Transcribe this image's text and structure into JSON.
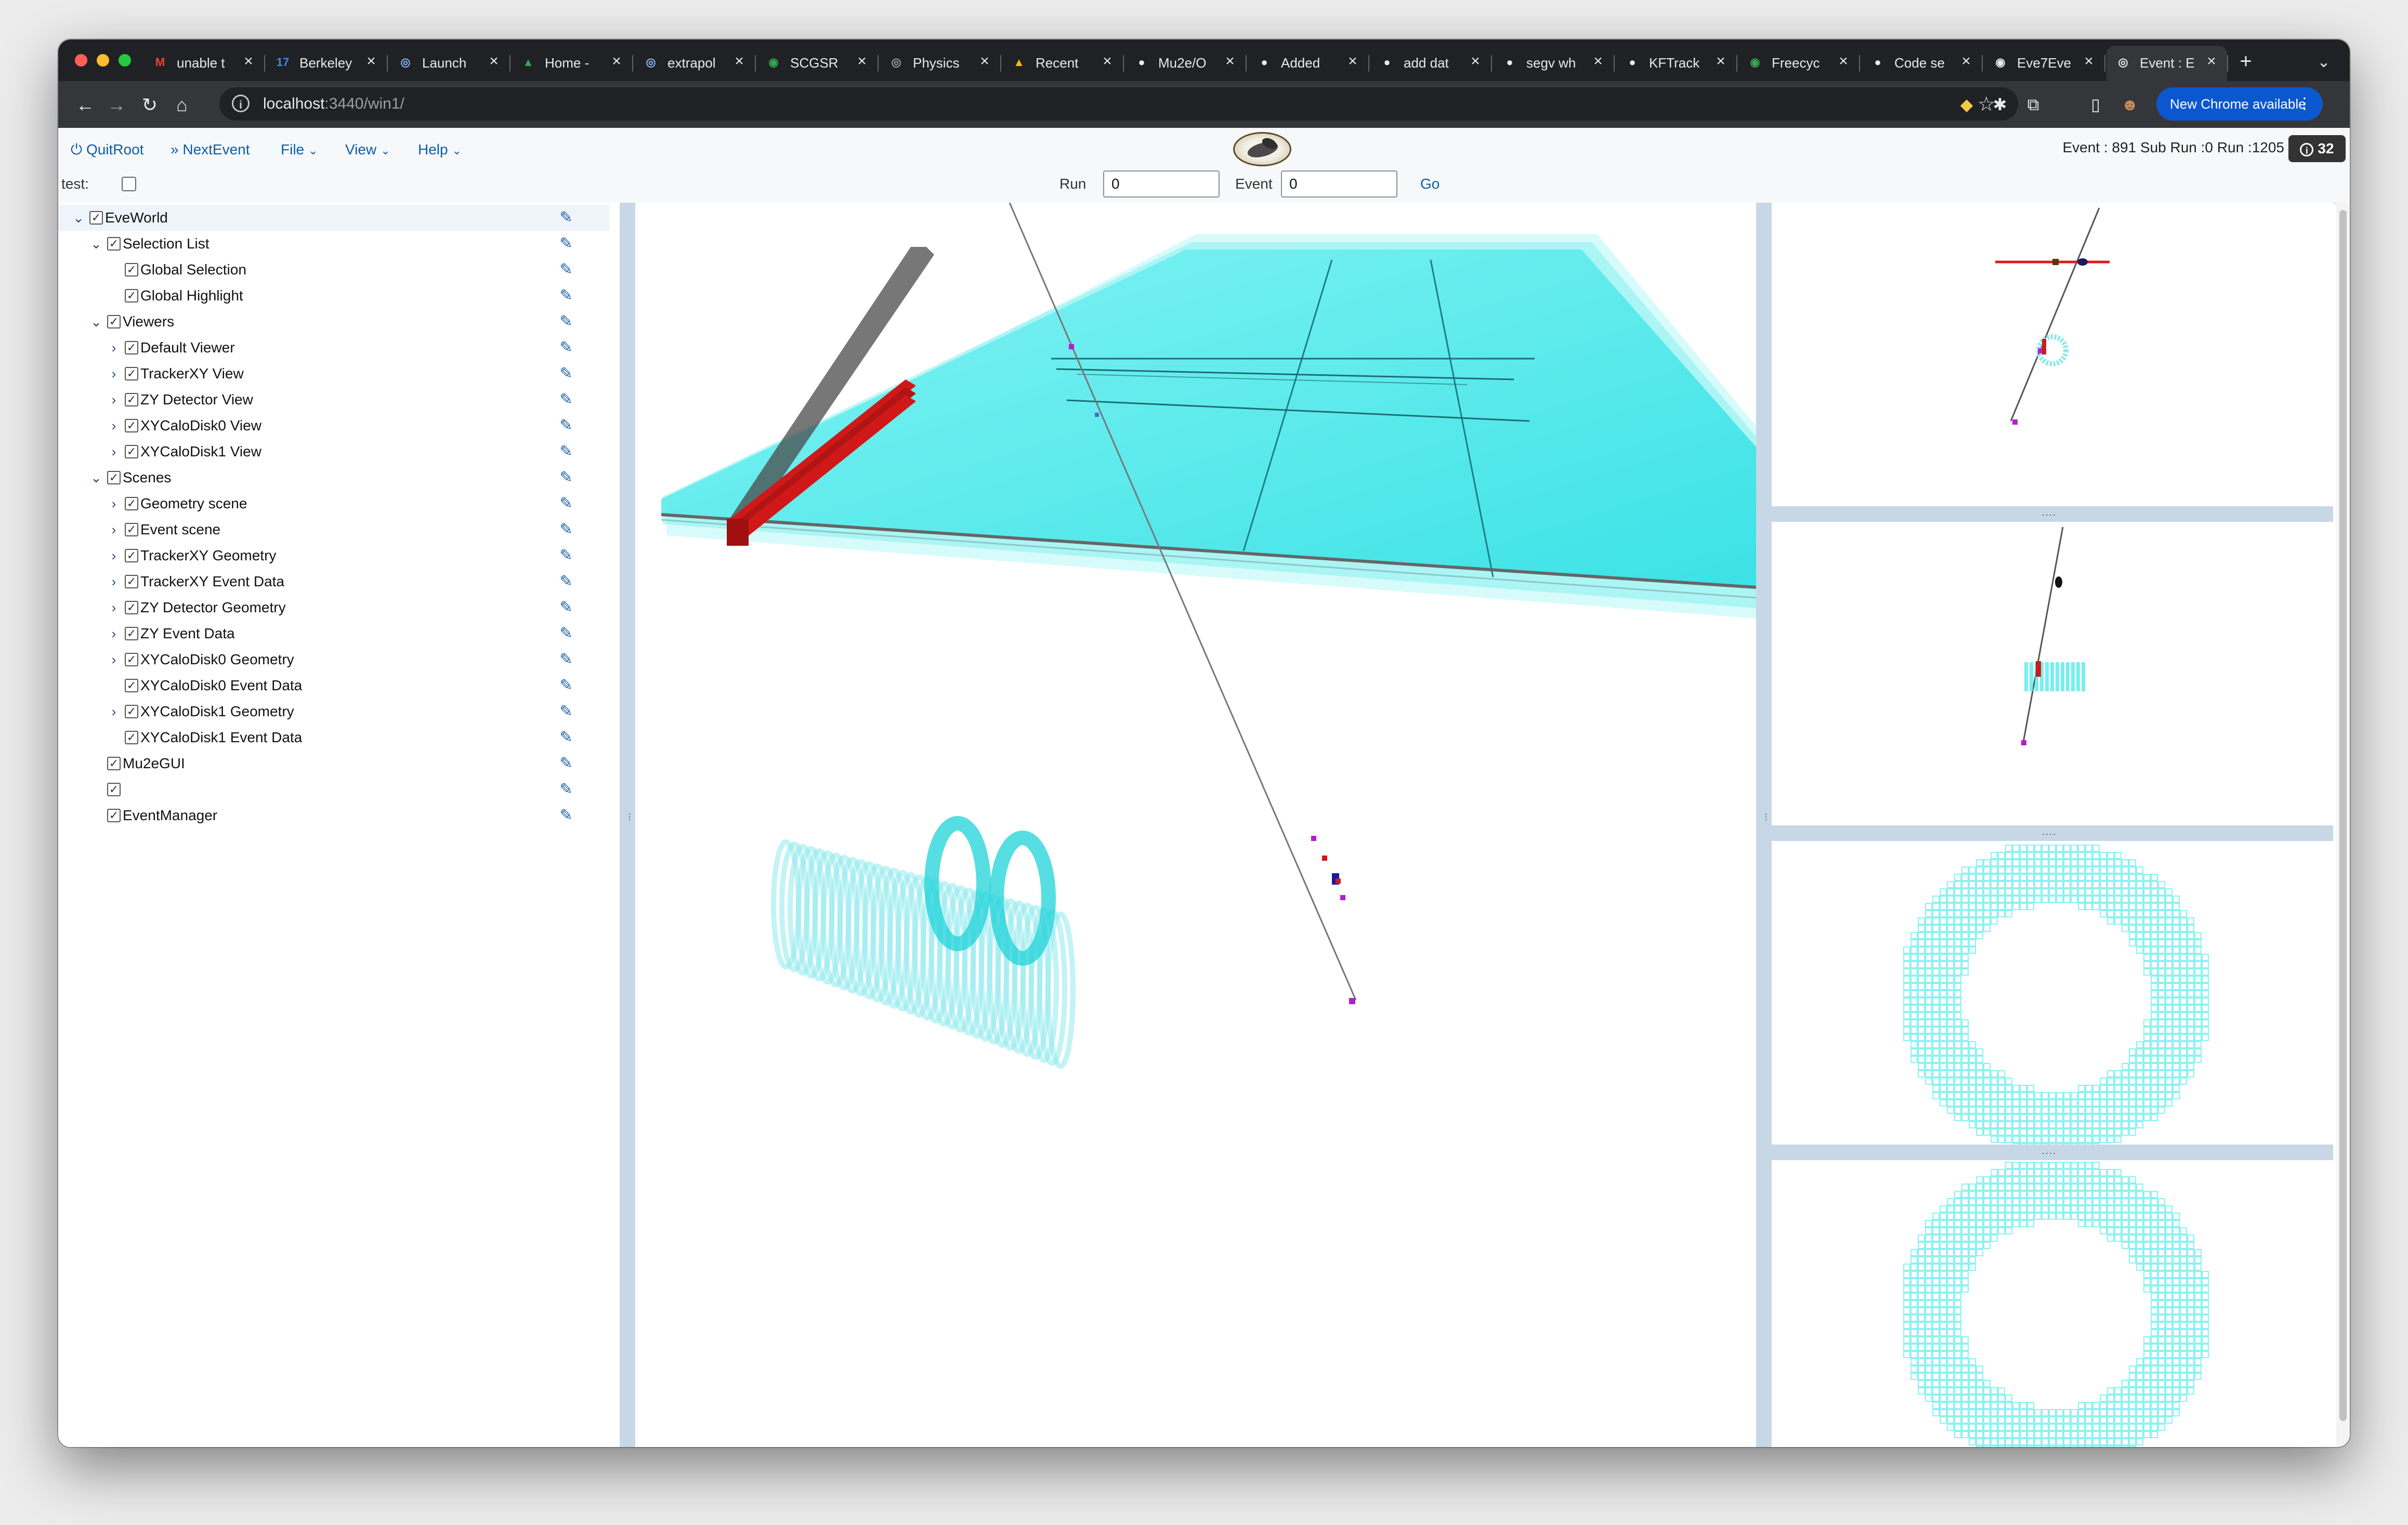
{
  "browser": {
    "tabs": [
      {
        "title": "unable t",
        "icon": "gmail-icon",
        "glyph": "M",
        "color": "#ea4335"
      },
      {
        "title": "Berkeley",
        "icon": "calendar-icon",
        "glyph": "17",
        "color": "#4285f4"
      },
      {
        "title": "Launch",
        "icon": "globe-icon",
        "glyph": "◎",
        "color": "#8ab4f8"
      },
      {
        "title": "Home -",
        "icon": "drive-icon",
        "glyph": "▲",
        "color": "#34a853"
      },
      {
        "title": "extrapol",
        "icon": "globe-icon",
        "glyph": "◎",
        "color": "#8ab4f8"
      },
      {
        "title": "SCGSR",
        "icon": "site-icon",
        "glyph": "◉",
        "color": "#34a853"
      },
      {
        "title": "Physics",
        "icon": "site-icon",
        "glyph": "◎",
        "color": "#9aa0a6"
      },
      {
        "title": "Recent",
        "icon": "drive-icon",
        "glyph": "▲",
        "color": "#fbbc04"
      },
      {
        "title": "Mu2e/O",
        "icon": "github-icon",
        "glyph": "●",
        "color": "#e8eaed"
      },
      {
        "title": "Added",
        "icon": "github-icon",
        "glyph": "●",
        "color": "#e8eaed"
      },
      {
        "title": "add dat",
        "icon": "github-icon",
        "glyph": "●",
        "color": "#e8eaed"
      },
      {
        "title": "segv wh",
        "icon": "github-icon",
        "glyph": "●",
        "color": "#e8eaed"
      },
      {
        "title": "KFTrack",
        "icon": "github-icon",
        "glyph": "●",
        "color": "#e8eaed"
      },
      {
        "title": "Freecyc",
        "icon": "site-icon",
        "glyph": "◉",
        "color": "#34a853"
      },
      {
        "title": "Code se",
        "icon": "github-icon",
        "glyph": "●",
        "color": "#e8eaed"
      },
      {
        "title": "Eve7Eve",
        "icon": "eye-icon",
        "glyph": "◉",
        "color": "#e8eaed"
      },
      {
        "title": "Event : E",
        "icon": "globe-icon",
        "glyph": "◎",
        "color": "#e8eaed"
      }
    ],
    "url_host": "localhost",
    "url_path": ":3440/win1/",
    "new_chrome_label": "New Chrome available"
  },
  "app": {
    "menu": {
      "quit": "QuitRoot",
      "next": "NextEvent",
      "file": "File",
      "view": "View",
      "help": "Help"
    },
    "event_info": "Event : 891 Sub Run :0 Run :1205",
    "badge_count": "32",
    "test_label": "test:",
    "run_label": "Run",
    "run_value": "0",
    "event_label": "Event",
    "event_value": "0",
    "go_label": "Go"
  },
  "tree": [
    {
      "label": "EveWorld",
      "level": 0,
      "expand": "open",
      "checked": true
    },
    {
      "label": "Selection List",
      "level": 1,
      "expand": "open",
      "checked": true
    },
    {
      "label": "Global Selection",
      "level": 2,
      "expand": "none",
      "checked": true
    },
    {
      "label": "Global Highlight",
      "level": 2,
      "expand": "none",
      "checked": true
    },
    {
      "label": "Viewers",
      "level": 1,
      "expand": "open",
      "checked": true
    },
    {
      "label": "Default Viewer",
      "level": 2,
      "expand": "closed",
      "checked": true
    },
    {
      "label": "TrackerXY View",
      "level": 2,
      "expand": "closed",
      "checked": true
    },
    {
      "label": "ZY Detector View",
      "level": 2,
      "expand": "closed",
      "checked": true
    },
    {
      "label": "XYCaloDisk0 View",
      "level": 2,
      "expand": "closed",
      "checked": true
    },
    {
      "label": "XYCaloDisk1 View",
      "level": 2,
      "expand": "closed",
      "checked": true
    },
    {
      "label": "Scenes",
      "level": 1,
      "expand": "open",
      "checked": true
    },
    {
      "label": "Geometry scene",
      "level": 2,
      "expand": "closed",
      "checked": true
    },
    {
      "label": "Event scene",
      "level": 2,
      "expand": "closed",
      "checked": true
    },
    {
      "label": "TrackerXY Geometry",
      "level": 2,
      "expand": "closed",
      "checked": true
    },
    {
      "label": "TrackerXY Event Data",
      "level": 2,
      "expand": "closed",
      "checked": true
    },
    {
      "label": "ZY Detector Geometry",
      "level": 2,
      "expand": "closed",
      "checked": true
    },
    {
      "label": "ZY Event Data",
      "level": 2,
      "expand": "closed",
      "checked": true
    },
    {
      "label": "XYCaloDisk0 Geometry",
      "level": 2,
      "expand": "closed",
      "checked": true
    },
    {
      "label": "XYCaloDisk0 Event Data",
      "level": 2,
      "expand": "none",
      "checked": true
    },
    {
      "label": "XYCaloDisk1 Geometry",
      "level": 2,
      "expand": "closed",
      "checked": true
    },
    {
      "label": "XYCaloDisk1 Event Data",
      "level": 2,
      "expand": "none",
      "checked": true
    },
    {
      "label": "Mu2eGUI",
      "level": 1,
      "expand": "none",
      "checked": true
    },
    {
      "label": "",
      "level": 1,
      "expand": "none",
      "checked": true
    },
    {
      "label": "EventManager",
      "level": 1,
      "expand": "none",
      "checked": true
    }
  ],
  "colors": {
    "accent_blue": "#0a5ea8",
    "crystal_cyan": "#3ee8ea",
    "hit_red": "#d01818",
    "hit_magenta": "#b020d0"
  }
}
